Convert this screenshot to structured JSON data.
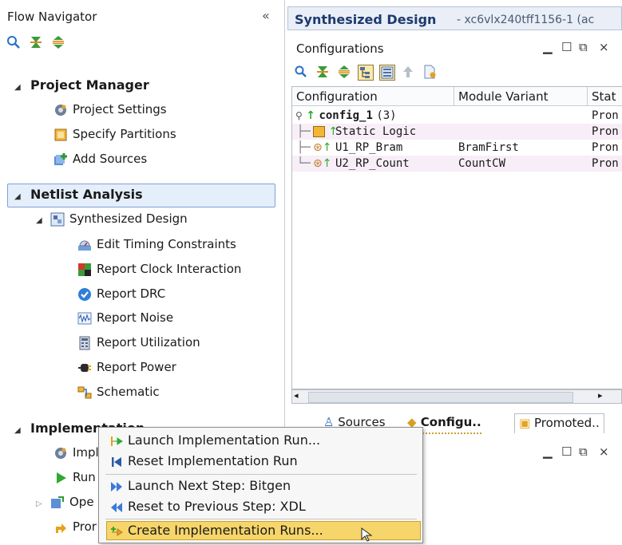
{
  "flow_navigator": {
    "title": "Flow Navigator",
    "collapse_glyph": "«",
    "project_manager": {
      "label": "Project Manager",
      "items": [
        "Project Settings",
        "Specify Partitions",
        "Add Sources"
      ]
    },
    "netlist_analysis": {
      "label": "Netlist Analysis",
      "synthesized_design": "Synthesized Design",
      "children": [
        "Edit Timing Constraints",
        "Report Clock Interaction",
        "Report DRC",
        "Report Noise",
        "Report Utilization",
        "Report Power",
        "Schematic"
      ]
    },
    "implementation": {
      "label": "Implementation",
      "items_partial": [
        "Impl",
        "Run",
        "Ope",
        "Pror"
      ]
    }
  },
  "design": {
    "title": "Synthesized Design",
    "subtitle": "- xc6vlx240tff1156-1 (ac"
  },
  "configurations": {
    "title": "Configurations",
    "columns": [
      "Configuration",
      "Module Variant",
      "Stat"
    ],
    "rows": [
      {
        "config": "config_1",
        "count": "(3)",
        "variant": "",
        "status": "Pron"
      },
      {
        "config": "Static Logic",
        "variant": "",
        "status": "Pron"
      },
      {
        "config": "U1_RP_Bram",
        "variant": "BramFirst",
        "status": "Pron"
      },
      {
        "config": "U2_RP_Count",
        "variant": "CountCW",
        "status": "Pron"
      }
    ]
  },
  "bottom_tabs": [
    "Sources",
    "Configu..",
    "Promoted.."
  ],
  "context_menu": {
    "items": [
      "Launch Implementation Run...",
      "Reset Implementation Run",
      "Launch Next Step: Bitgen",
      "Reset to Previous Step: XDL",
      "Create Implementation Runs..."
    ]
  },
  "colors": {
    "highlight": "#f6d56a",
    "selection": "#e5eefb",
    "accent": "#1d3a6e"
  }
}
